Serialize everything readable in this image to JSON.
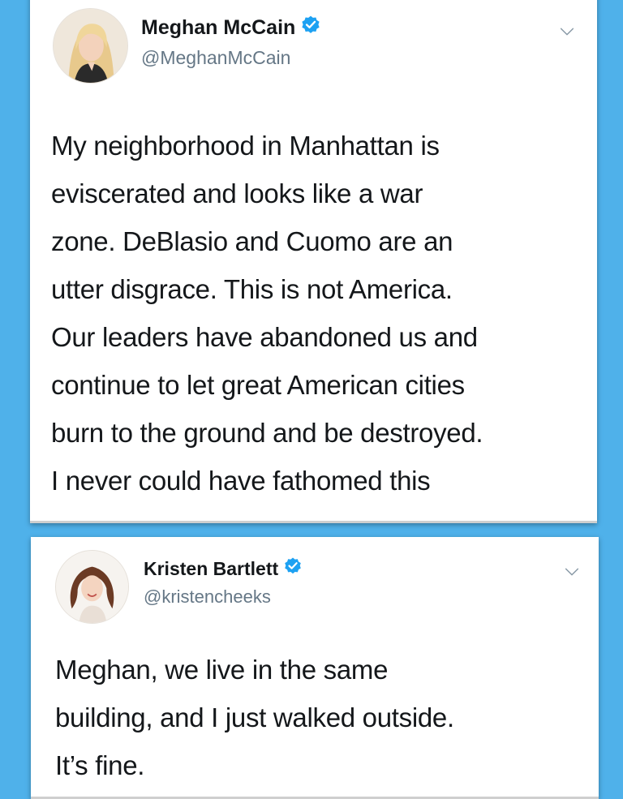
{
  "colors": {
    "background": "#4fb1ea",
    "verified": "#1da1f2",
    "text_primary": "#14171a",
    "text_secondary": "#657786"
  },
  "tweets": [
    {
      "display_name": "Meghan McCain",
      "handle": "@MeghanMcCain",
      "verified": true,
      "avatar_icon": "avatar-blonde-woman",
      "text": "My neighborhood in Manhattan is\neviscerated and looks like a war\nzone. DeBlasio and Cuomo are an\nutter disgrace. This is not America.\nOur leaders have abandoned us and\ncontinue to let great American cities\nburn to the ground and be destroyed.\nI never could have fathomed this"
    },
    {
      "display_name": "Kristen Bartlett",
      "handle": "@kristencheeks",
      "verified": true,
      "avatar_icon": "avatar-brunette-woman",
      "text": "Meghan, we live in the same\nbuilding, and I just walked outside.\nIt’s fine."
    }
  ]
}
